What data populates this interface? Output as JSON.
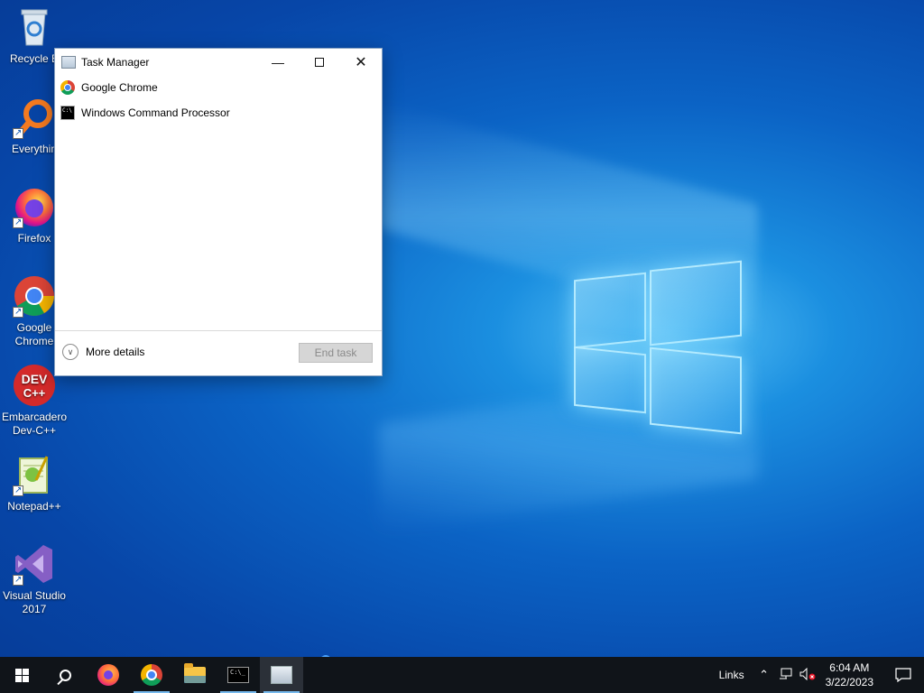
{
  "desktop": {
    "icons": [
      {
        "label": "Recycle Bin",
        "icon": "recycle-bin-icon"
      },
      {
        "label": "Everything",
        "icon": "everything-search-icon"
      },
      {
        "label": "Firefox",
        "icon": "firefox-icon"
      },
      {
        "label": "Google Chrome",
        "icon": "chrome-icon"
      },
      {
        "label": "Embarcadero Dev-C++",
        "icon": "devcpp-icon"
      },
      {
        "label": "Notepad++",
        "icon": "notepadpp-icon"
      },
      {
        "label": "Visual Studio 2017",
        "icon": "visual-studio-icon"
      }
    ],
    "icon_label_visible": {
      "recycle": "Recycle B",
      "everything": "Everythin",
      "firefox": "Firefox",
      "chrome_l1": "Google",
      "chrome_l2": "Chrome",
      "devcpp_l1": "Embarcadero",
      "devcpp_l2": "Dev-C++",
      "notepad": "Notepad++",
      "vs_l1": "Visual Studio",
      "vs_l2": "2017",
      "devcpp_badge": "DEV\nC++"
    }
  },
  "task_manager": {
    "title": "Task Manager",
    "apps": [
      {
        "name": "Google Chrome",
        "icon": "chrome-icon"
      },
      {
        "name": "Windows Command Processor",
        "icon": "cmd-icon"
      }
    ],
    "more_details_label": "More details",
    "end_task_label": "End task",
    "end_task_enabled": false
  },
  "taskbar": {
    "pinned": [
      "start",
      "search",
      "firefox",
      "chrome",
      "file-explorer",
      "cmd",
      "task-manager"
    ],
    "active": [
      "cmd",
      "task-manager"
    ],
    "tray": {
      "links_label": "Links",
      "time": "6:04 AM",
      "date": "3/22/2023"
    }
  },
  "colors": {
    "desktop_bg": "#0b63c5",
    "taskbar_bg": "#101419",
    "active_indicator": "#76b9ed"
  }
}
